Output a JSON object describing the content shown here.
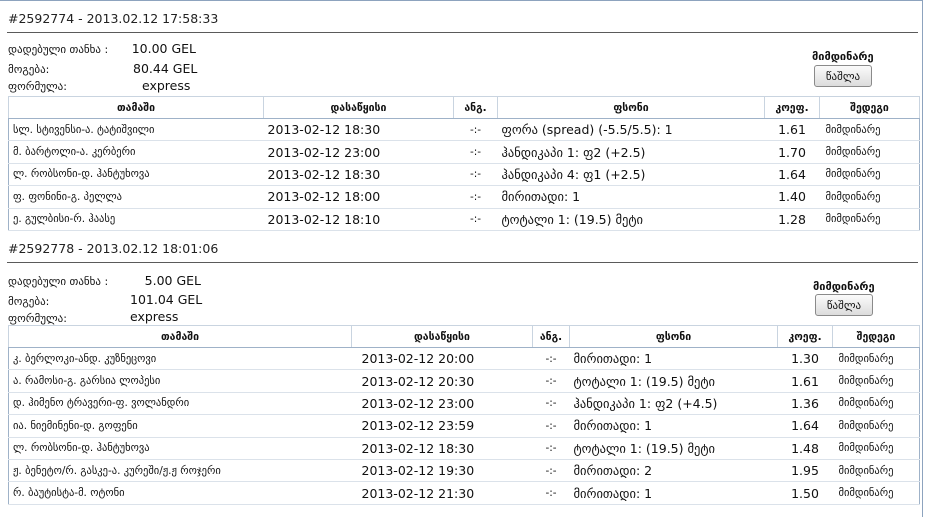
{
  "slips": [
    {
      "header": "#2592774 - 2013.02.12 17:58:33",
      "stake_label": "დადებული თანხა :",
      "stake_value": "10.00 GEL",
      "win_label": "მოგება:",
      "win_value": "80.44 GEL",
      "formula_label": "ფორმულა:",
      "formula_value": "express",
      "status": "მიმდინარე",
      "delete_label": "წაშლა",
      "columns": [
        "თამაში",
        "დასაწყისი",
        "ანგ.",
        "ფსონი",
        "კოეფ.",
        "შედეგი"
      ],
      "rows": [
        {
          "match": "სლ. სტივენსი-ა. ტატიშვილი",
          "start": "2013-02-12 18:30",
          "score": "-:-",
          "bet": "ფორა (spread) (-5.5/5.5): 1",
          "odds": "1.61",
          "result": "მიმდინარე"
        },
        {
          "match": "მ. ბარტოლი-ა. კერბერი",
          "start": "2013-02-12 23:00",
          "score": "-:-",
          "bet": "ჰანდიკაპი 1: ფ2 (+2.5)",
          "odds": "1.70",
          "result": "მიმდინარე"
        },
        {
          "match": "ლ. რობსონი-დ. ჰანტუხოვა",
          "start": "2013-02-12 18:30",
          "score": "-:-",
          "bet": "ჰანდიკაპი 4: ფ1 (+2.5)",
          "odds": "1.64",
          "result": "მიმდინარე"
        },
        {
          "match": "ფ. ფონინი-გ. პელლა",
          "start": "2013-02-12 18:00",
          "score": "-:-",
          "bet": "მირითადი: 1",
          "odds": "1.40",
          "result": "მიმდინარე"
        },
        {
          "match": "ე. გულბისი-რ. ჰაასე",
          "start": "2013-02-12 18:10",
          "score": "-:-",
          "bet": "ტოტალი 1: (19.5) მეტი",
          "odds": "1.28",
          "result": "მიმდინარე"
        }
      ]
    },
    {
      "header": "#2592778 - 2013.02.12 18:01:06",
      "stake_label": "დადებული თანხა :",
      "stake_value": "5.00 GEL",
      "win_label": "მოგება:",
      "win_value": "101.04 GEL",
      "formula_label": "ფორმულა:",
      "formula_value": "express",
      "status": "მიმდინარე",
      "delete_label": "წაშლა",
      "columns": [
        "თამაში",
        "დასაწყისი",
        "ანგ.",
        "ფსონი",
        "კოეფ.",
        "შედეგი"
      ],
      "rows": [
        {
          "match": "კ. ბერლოკი-ანდ. კუზნეცოვი",
          "start": "2013-02-12 20:00",
          "score": "-:-",
          "bet": "მირითადი: 1",
          "odds": "1.30",
          "result": "მიმდინარე"
        },
        {
          "match": "ა. რამოსი-გ. გარსია ლოპესი",
          "start": "2013-02-12 20:30",
          "score": "-:-",
          "bet": "ტოტალი 1: (19.5) მეტი",
          "odds": "1.61",
          "result": "მიმდინარე"
        },
        {
          "match": "დ. ჰიმენო ტრავერი-ფ. ვოლანდრი",
          "start": "2013-02-12 23:00",
          "score": "-:-",
          "bet": "ჰანდიკაპი 1: ფ2 (+4.5)",
          "odds": "1.36",
          "result": "მიმდინარე"
        },
        {
          "match": "ია. ნიემინენი-დ. გოფენი",
          "start": "2013-02-12 23:59",
          "score": "-:-",
          "bet": "მირითადი: 1",
          "odds": "1.64",
          "result": "მიმდინარე"
        },
        {
          "match": "ლ. რობსონი-დ. ჰანტუხოვა",
          "start": "2013-02-12 18:30",
          "score": "-:-",
          "bet": "ტოტალი 1: (19.5) მეტი",
          "odds": "1.48",
          "result": "მიმდინარე"
        },
        {
          "match": "ჟ. ბენეტო/რ. გასკე-ა. კურეში/ჟ.ჟ როჯერი",
          "start": "2013-02-12 19:30",
          "score": "-:-",
          "bet": "მირითადი: 2",
          "odds": "1.95",
          "result": "მიმდინარე"
        },
        {
          "match": "რ. ბაუტისტა-მ. ოტონი",
          "start": "2013-02-12 21:30",
          "score": "-:-",
          "bet": "მირითადი: 1",
          "odds": "1.50",
          "result": "მიმდინარე"
        }
      ]
    }
  ]
}
